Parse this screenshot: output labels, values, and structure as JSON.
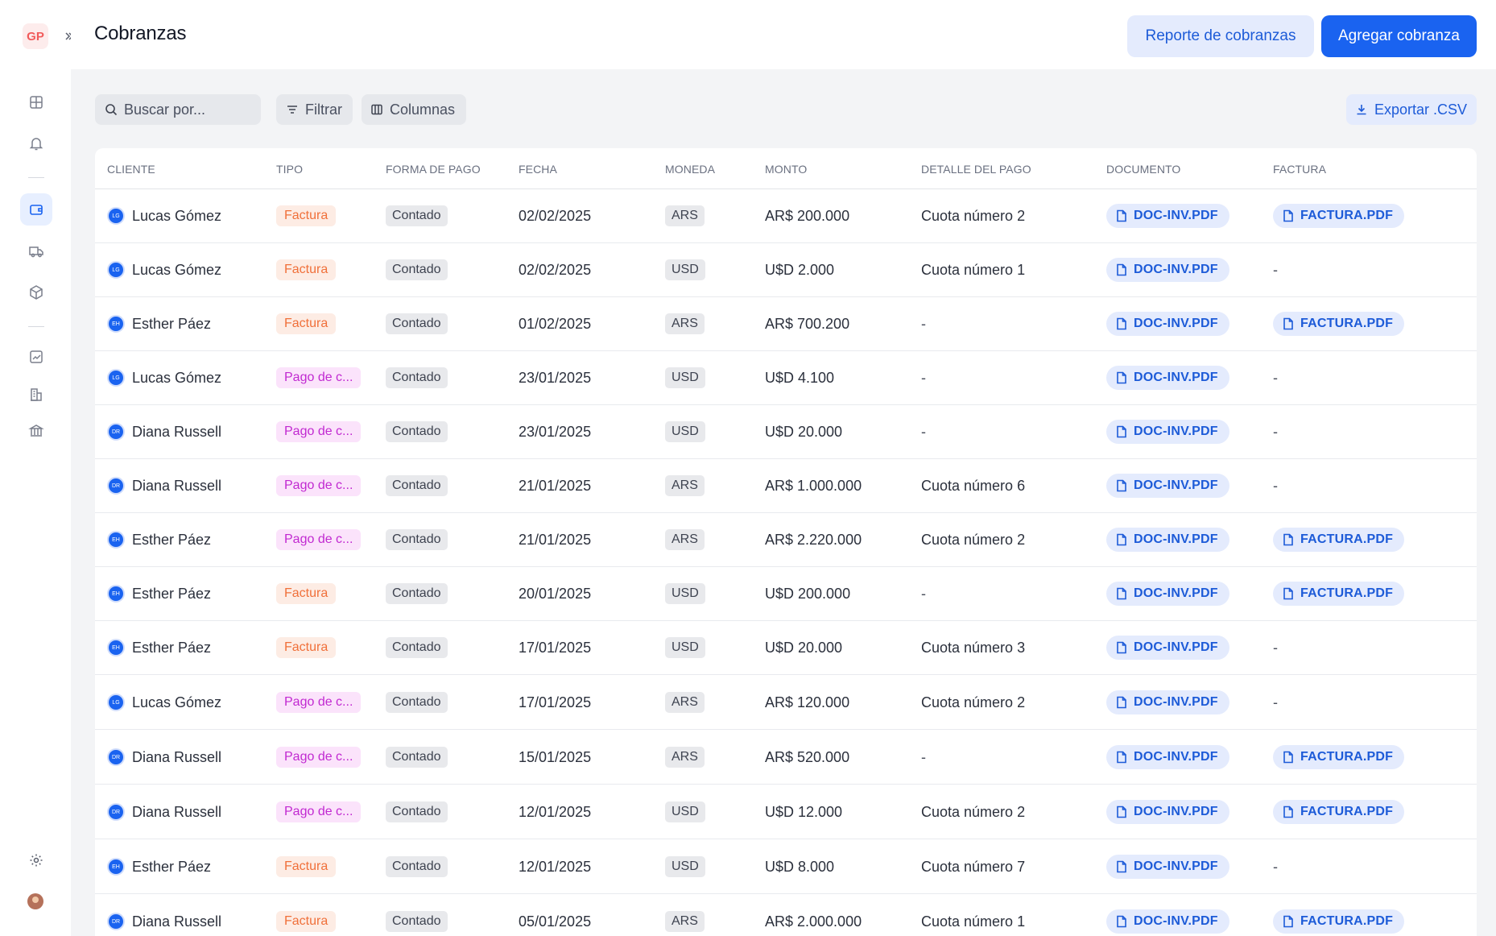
{
  "app": {
    "logo_text": "GP",
    "title": "Cobranzas",
    "accent_color": "#1a63f0",
    "sidebar": [
      {
        "icon": "dashboard-grid-icon",
        "active": false
      },
      {
        "icon": "bell-icon",
        "active": false
      },
      {
        "icon": "wallet-icon",
        "active": true
      },
      {
        "icon": "truck-icon",
        "active": false
      },
      {
        "icon": "box-icon",
        "active": false
      },
      {
        "icon": "chart-icon",
        "active": false
      },
      {
        "icon": "building-icon",
        "active": false
      },
      {
        "icon": "bank-icon",
        "active": false
      },
      {
        "icon": "gear-icon",
        "active": false
      }
    ]
  },
  "header": {
    "report_button": "Reporte de cobranzas",
    "add_button": "Agregar cobranza"
  },
  "toolbar": {
    "search_placeholder": "Buscar por...",
    "filter_label": "Filtrar",
    "columns_label": "Columnas",
    "export_label": "Exportar .CSV"
  },
  "table": {
    "headers": [
      "CLIENTE",
      "TIPO",
      "FORMA DE PAGO",
      "FECHA",
      "MONEDA",
      "MONTO",
      "DETALLE DEL PAGO",
      "DOCUMENTO",
      "FACTURA"
    ],
    "rows": [
      {
        "initials": "LG",
        "cliente": "Lucas Gómez",
        "tipo": "Factura",
        "tipo_kind": "factura",
        "forma": "Contado",
        "fecha": "02/02/2025",
        "moneda": "ARS",
        "monto": "AR$ 200.000",
        "detalle": "Cuota número 2",
        "documento": "DOC-INV.PDF",
        "factura": "FACTURA.PDF"
      },
      {
        "initials": "LG",
        "cliente": "Lucas Gómez",
        "tipo": "Factura",
        "tipo_kind": "factura",
        "forma": "Contado",
        "fecha": "02/02/2025",
        "moneda": "USD",
        "monto": "U$D 2.000",
        "detalle": "Cuota número 1",
        "documento": "DOC-INV.PDF",
        "factura": "-"
      },
      {
        "initials": "EH",
        "cliente": "Esther Páez",
        "tipo": "Factura",
        "tipo_kind": "factura",
        "forma": "Contado",
        "fecha": "01/02/2025",
        "moneda": "ARS",
        "monto": "AR$ 700.200",
        "detalle": "-",
        "documento": "DOC-INV.PDF",
        "factura": "FACTURA.PDF"
      },
      {
        "initials": "LG",
        "cliente": "Lucas Gómez",
        "tipo": "Pago de c...",
        "tipo_kind": "pago",
        "forma": "Contado",
        "fecha": "23/01/2025",
        "moneda": "USD",
        "monto": "U$D 4.100",
        "detalle": "-",
        "documento": "DOC-INV.PDF",
        "factura": "-"
      },
      {
        "initials": "DR",
        "cliente": "Diana Russell",
        "tipo": "Pago de c...",
        "tipo_kind": "pago",
        "forma": "Contado",
        "fecha": "23/01/2025",
        "moneda": "USD",
        "monto": "U$D 20.000",
        "detalle": "-",
        "documento": "DOC-INV.PDF",
        "factura": "-"
      },
      {
        "initials": "DR",
        "cliente": "Diana Russell",
        "tipo": "Pago de c...",
        "tipo_kind": "pago",
        "forma": "Contado",
        "fecha": "21/01/2025",
        "moneda": "ARS",
        "monto": "AR$ 1.000.000",
        "detalle": "Cuota número 6",
        "documento": "DOC-INV.PDF",
        "factura": "-"
      },
      {
        "initials": "EH",
        "cliente": "Esther Páez",
        "tipo": "Pago de c...",
        "tipo_kind": "pago",
        "forma": "Contado",
        "fecha": "21/01/2025",
        "moneda": "ARS",
        "monto": "AR$ 2.220.000",
        "detalle": "Cuota número 2",
        "documento": "DOC-INV.PDF",
        "factura": "FACTURA.PDF"
      },
      {
        "initials": "EH",
        "cliente": "Esther Páez",
        "tipo": "Factura",
        "tipo_kind": "factura",
        "forma": "Contado",
        "fecha": "20/01/2025",
        "moneda": "USD",
        "monto": "U$D 200.000",
        "detalle": "-",
        "documento": "DOC-INV.PDF",
        "factura": "FACTURA.PDF"
      },
      {
        "initials": "EH",
        "cliente": "Esther Páez",
        "tipo": "Factura",
        "tipo_kind": "factura",
        "forma": "Contado",
        "fecha": "17/01/2025",
        "moneda": "USD",
        "monto": "U$D 20.000",
        "detalle": "Cuota número 3",
        "documento": "DOC-INV.PDF",
        "factura": "-"
      },
      {
        "initials": "LG",
        "cliente": "Lucas Gómez",
        "tipo": "Pago de c...",
        "tipo_kind": "pago",
        "forma": "Contado",
        "fecha": "17/01/2025",
        "moneda": "ARS",
        "monto": "AR$ 120.000",
        "detalle": "Cuota número 2",
        "documento": "DOC-INV.PDF",
        "factura": "-"
      },
      {
        "initials": "DR",
        "cliente": "Diana Russell",
        "tipo": "Pago de c...",
        "tipo_kind": "pago",
        "forma": "Contado",
        "fecha": "15/01/2025",
        "moneda": "ARS",
        "monto": "AR$ 520.000",
        "detalle": "-",
        "documento": "DOC-INV.PDF",
        "factura": "FACTURA.PDF"
      },
      {
        "initials": "DR",
        "cliente": "Diana Russell",
        "tipo": "Pago de c...",
        "tipo_kind": "pago",
        "forma": "Contado",
        "fecha": "12/01/2025",
        "moneda": "USD",
        "monto": "U$D 12.000",
        "detalle": "Cuota número 2",
        "documento": "DOC-INV.PDF",
        "factura": "FACTURA.PDF"
      },
      {
        "initials": "EH",
        "cliente": "Esther Páez",
        "tipo": "Factura",
        "tipo_kind": "factura",
        "forma": "Contado",
        "fecha": "12/01/2025",
        "moneda": "USD",
        "monto": "U$D 8.000",
        "detalle": "Cuota número 7",
        "documento": "DOC-INV.PDF",
        "factura": "-"
      },
      {
        "initials": "DR",
        "cliente": "Diana Russell",
        "tipo": "Factura",
        "tipo_kind": "factura",
        "forma": "Contado",
        "fecha": "05/01/2025",
        "moneda": "ARS",
        "monto": "AR$ 2.000.000",
        "detalle": "Cuota número 1",
        "documento": "DOC-INV.PDF",
        "factura": "FACTURA.PDF"
      }
    ]
  }
}
